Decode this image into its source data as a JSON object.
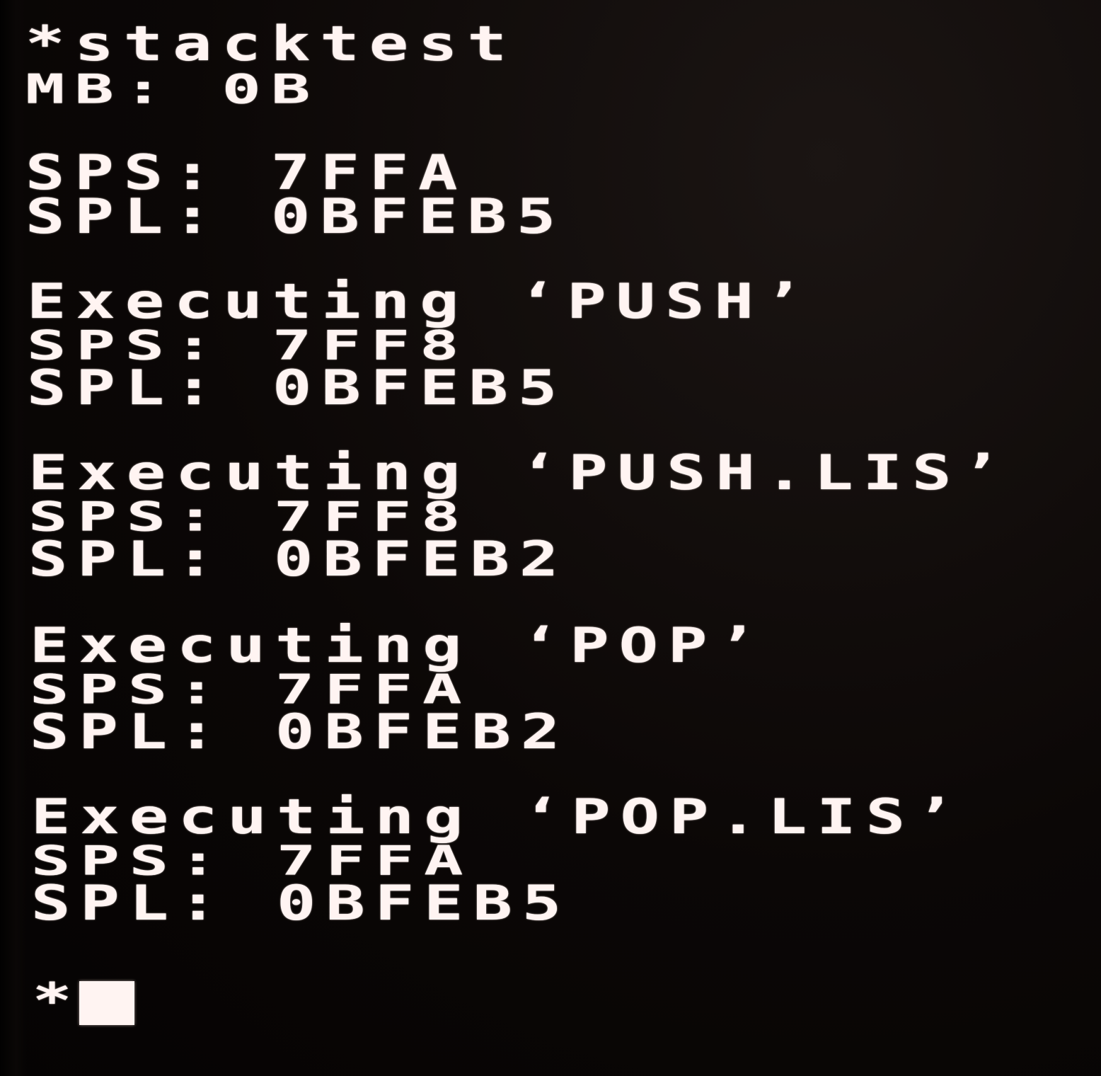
{
  "terminal": {
    "command": "*stacktest",
    "mb_line": "MB: 0B",
    "initial_sps": "SPS: 7FFA",
    "initial_spl": "SPL: 0BFEB5",
    "blocks": [
      {
        "exec": "Executing ‘PUSH’",
        "sps": "SPS: 7FF8",
        "spl": "SPL: 0BFEB5"
      },
      {
        "exec": "Executing ‘PUSH.LIS’",
        "sps": "SPS: 7FF8",
        "spl": "SPL: 0BFEB2"
      },
      {
        "exec": "Executing ‘POP’",
        "sps": "SPS: 7FFA",
        "spl": "SPL: 0BFEB2"
      },
      {
        "exec": "Executing ‘POP.LIS’",
        "sps": "SPS: 7FFA",
        "spl": "SPL: 0BFEB5"
      }
    ],
    "prompt": "*"
  },
  "colors": {
    "background": "#070505",
    "text": "#fff4f2"
  }
}
